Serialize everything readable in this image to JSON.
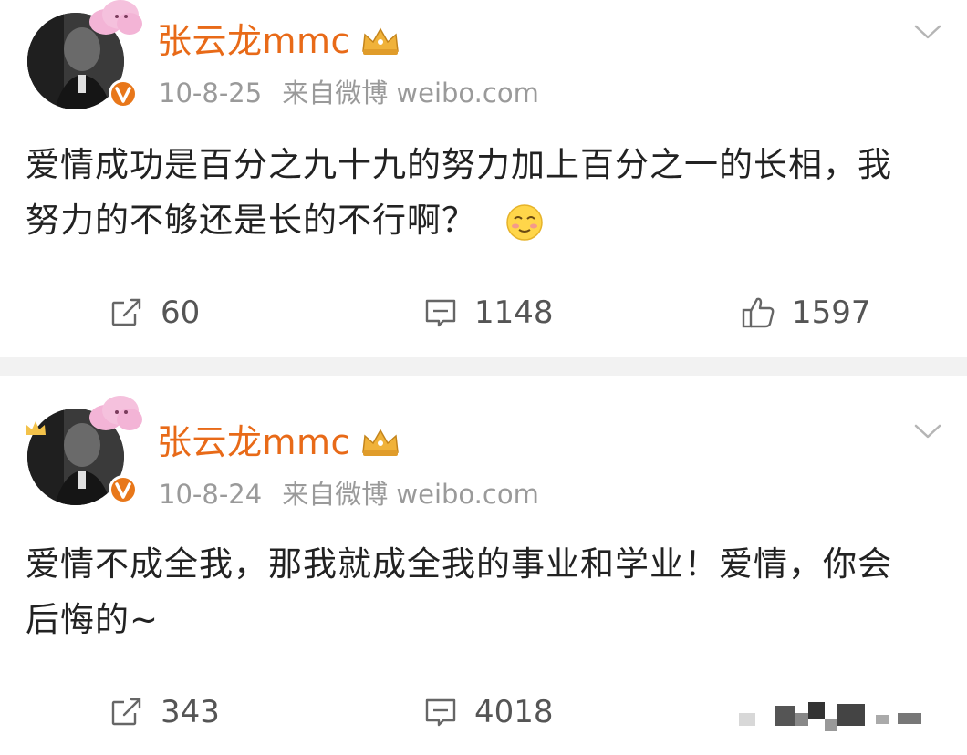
{
  "posts": [
    {
      "username": "张云龙mmc",
      "date": "10-8-25",
      "source": "来自微博 weibo.com",
      "text": "爱情成功是百分之九十九的努力加上百分之一的长相，我努力的不够还是长的不行啊？",
      "emoji": "blush-emoji",
      "repost_count": "60",
      "comment_count": "1148",
      "like_count": "1597"
    },
    {
      "username": "张云龙mmc",
      "date": "10-8-24",
      "source": "来自微博 weibo.com",
      "text": "爱情不成全我，那我就成全我的事业和学业！爱情，你会后悔的~",
      "repost_count": "343",
      "comment_count": "4018"
    }
  ],
  "colors": {
    "username": "#e86a18",
    "meta": "#9a9a9a",
    "body_text": "#222222",
    "action_text": "#555555",
    "separator": "#f2f2f2",
    "vip_badge": "#e8771a",
    "crown_gold": "#f0b23a"
  },
  "icons": {
    "repost": "repost-icon",
    "comment": "comment-icon",
    "like": "thumbs-up-icon",
    "chevron": "chevron-down-icon",
    "crown": "crown-icon",
    "vip": "verified-badge-icon"
  }
}
